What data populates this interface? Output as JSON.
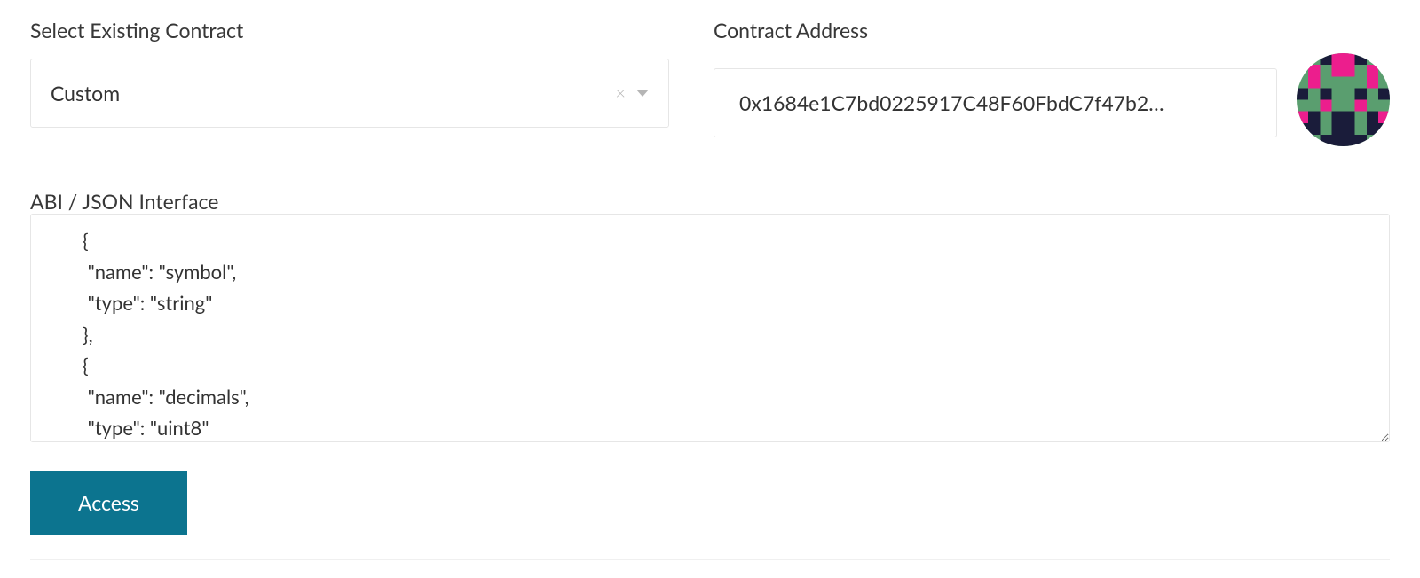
{
  "selectContract": {
    "label": "Select Existing Contract",
    "value": "Custom"
  },
  "contractAddress": {
    "label": "Contract Address",
    "value": "0x1684e1C7bd0225917C48F60FbdC7f47b2…"
  },
  "abi": {
    "label": "ABI / JSON Interface",
    "value": "{\n \"name\": \"symbol\",\n \"type\": \"string\"\n},\n{\n \"name\": \"decimals\",\n \"type\": \"uint8\"\n}"
  },
  "accessButton": {
    "label": "Access"
  },
  "colors": {
    "primary": "#0C748F",
    "identicon_bg": "#5A9E6F",
    "identicon_fg1": "#EC1E8D",
    "identicon_fg2": "#1A1C3A"
  }
}
